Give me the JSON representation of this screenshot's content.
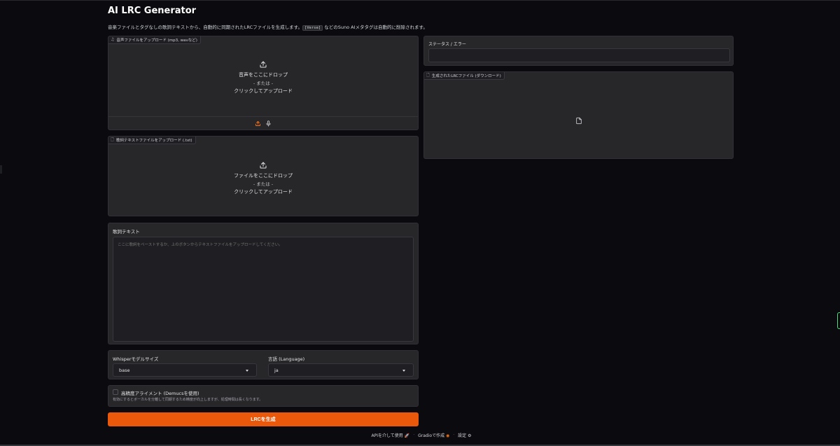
{
  "app": {
    "title": "AI LRC Generator",
    "description_prefix": "音楽ファイルとタグなしの歌詞テキストから、自動的に同期されたLRCファイルを生成します。",
    "description_code": "[Verse]",
    "description_suffix": " などのSuno AIメタタグは自動的に削除されます。"
  },
  "audio_upload": {
    "label": "音声ファイルをアップロード (mp3, wavなど)",
    "drop_text": "音声をここにドロップ",
    "or_text": "- または -",
    "click_text": "クリックしてアップロード"
  },
  "lyrics_upload": {
    "label": "歌詞テキストファイルをアップロード (.txt)",
    "drop_text": "ファイルをここにドロップ",
    "or_text": "- または -",
    "click_text": "クリックしてアップロード"
  },
  "lyrics_text": {
    "label": "歌詞テキスト",
    "placeholder": "ここに歌詞をペーストするか、上のボタンからテキストファイルをアップロードしてください。"
  },
  "whisper_model": {
    "label": "Whisperモデルサイズ",
    "value": "base"
  },
  "language": {
    "label": "言語 (Language)",
    "value": "ja"
  },
  "alignment": {
    "label": "高精度アライメント (Demucsを使用)",
    "hint": "有効にするとボーカルを分離して同期するため精度が向上しますが、処理時間は長くなります。",
    "checked": false
  },
  "generate_button": {
    "label": "LRCを生成"
  },
  "status": {
    "label": "ステータス / エラー",
    "value": ""
  },
  "output_file": {
    "label": "生成されたLRCファイル (ダウンロード)"
  },
  "footer": {
    "api_label": "APIを介して使用",
    "gradio_label": "Gradioで作成",
    "settings_label": "設定",
    "separator": "·"
  },
  "colors": {
    "background": "#0b0b0f",
    "panel": "#27272a",
    "accent": "#ea580c"
  },
  "icons": [
    "music-icon",
    "upload-icon",
    "mic-icon",
    "file-icon",
    "rocket-icon",
    "gradio-logo-icon",
    "gear-icon",
    "chevron-down-icon"
  ]
}
